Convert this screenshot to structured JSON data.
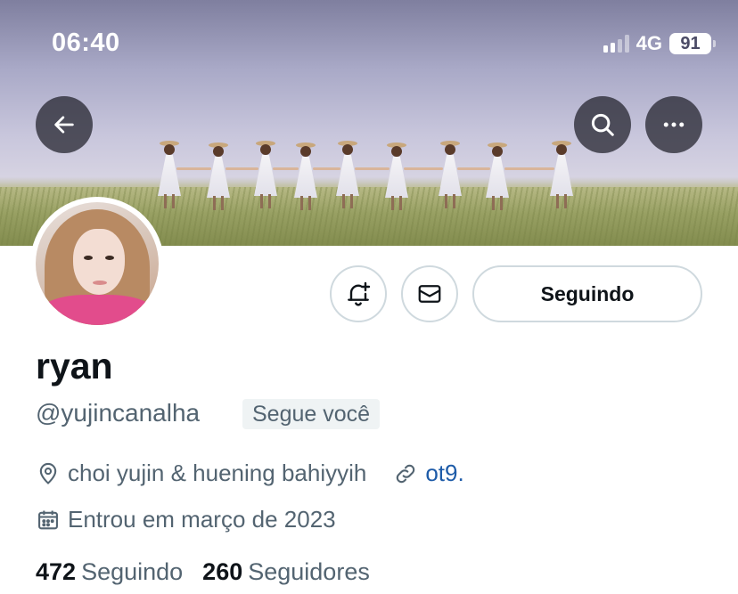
{
  "status_bar": {
    "time": "06:40",
    "network": "4G",
    "battery": "91"
  },
  "header": {
    "back_icon": "arrow-left-icon",
    "search_icon": "search-icon",
    "more_icon": "more-horizontal-icon"
  },
  "actions": {
    "notify_icon": "bell-plus-icon",
    "message_icon": "envelope-icon",
    "follow_label": "Seguindo"
  },
  "profile": {
    "name": "ryan",
    "handle": "@yujincanalha",
    "follows_you": "Segue você",
    "location": "choi yujin & huening bahiyyih",
    "link": "ot9.",
    "joined": "Entrou em março de 2023",
    "following_count": "472",
    "following_label": "Seguindo",
    "followers_count": "260",
    "followers_label": "Seguidores"
  },
  "colors": {
    "link": "#1d5ba8",
    "secondary_text": "#536471",
    "border": "#cfd9de"
  }
}
